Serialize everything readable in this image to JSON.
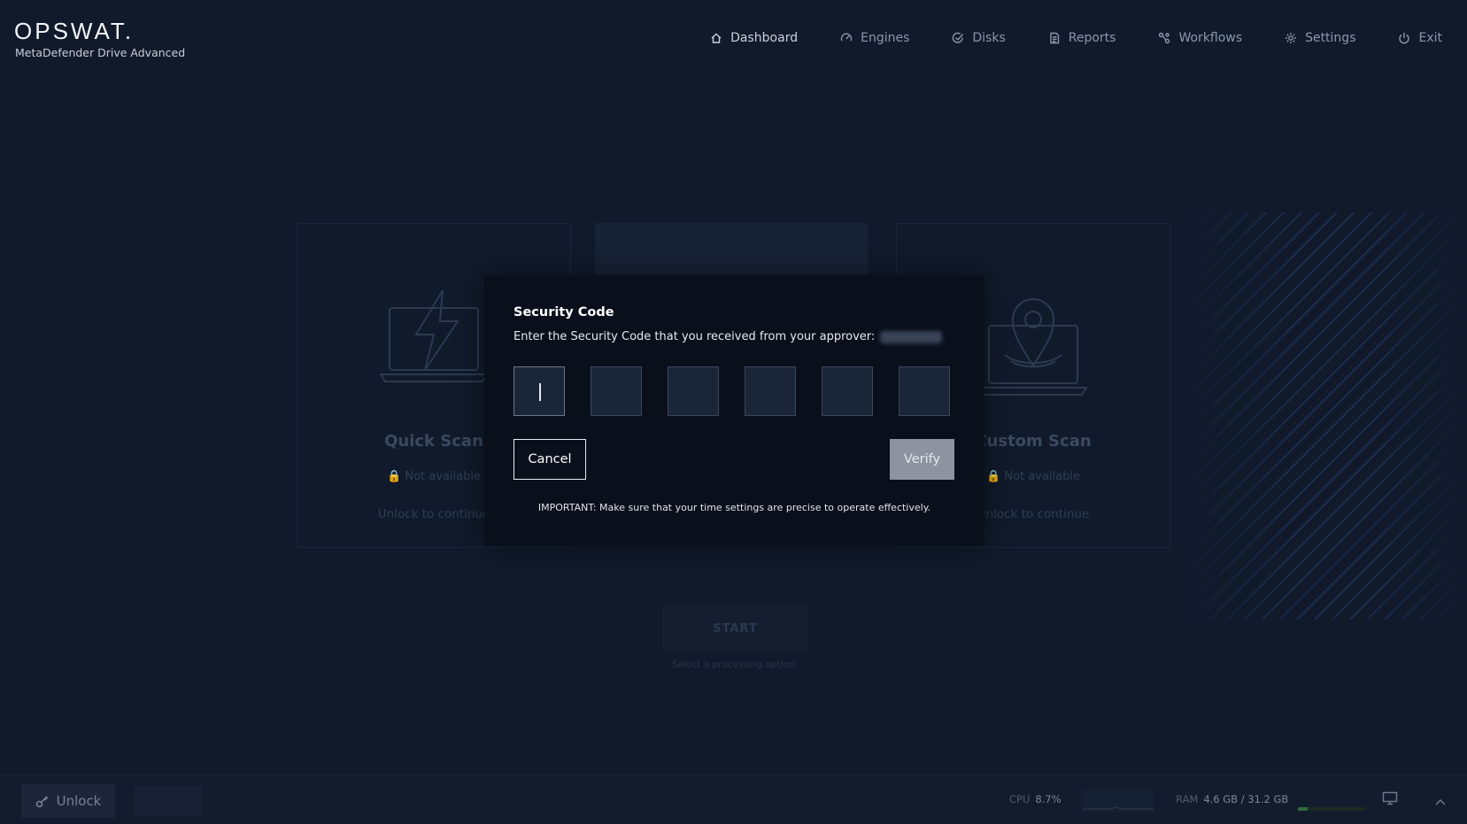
{
  "app": {
    "logo": "OPSWAT.",
    "subtitle": "MetaDefender Drive Advanced"
  },
  "nav": {
    "items": [
      {
        "label": "Dashboard",
        "icon": "home-icon"
      },
      {
        "label": "Engines",
        "icon": "gauge-icon"
      },
      {
        "label": "Disks",
        "icon": "check-shield-icon"
      },
      {
        "label": "Reports",
        "icon": "document-icon"
      },
      {
        "label": "Workflows",
        "icon": "workflow-icon"
      },
      {
        "label": "Settings",
        "icon": "gear-icon"
      },
      {
        "label": "Exit",
        "icon": "power-icon"
      }
    ]
  },
  "cards": {
    "quick": {
      "title": "Quick Scan",
      "status": "Not available",
      "hint": "Unlock to continue"
    },
    "custom": {
      "title": "Custom Scan",
      "status": "Not available",
      "hint": "Unlock to continue"
    }
  },
  "start": {
    "label": "START",
    "hint": "Select a processing option."
  },
  "modal": {
    "title": "Security Code",
    "description": "Enter the Security Code that you received from your approver:",
    "code_boxes": [
      "",
      "",
      "",
      "",
      "",
      ""
    ],
    "cancel_label": "Cancel",
    "verify_label": "Verify",
    "note": "IMPORTANT: Make sure that your time settings are precise to operate effectively."
  },
  "footer": {
    "unlock_label": "Unlock",
    "cpu_label": "CPU",
    "cpu_value": "8.7%",
    "ram_label": "RAM",
    "ram_value": "4.6 GB / 31.2 GB",
    "ram_usage_fraction": 0.15
  },
  "colors": {
    "background": "#111a2b",
    "modal": "#0a0f1c",
    "verify_disabled": "#8d94a0",
    "stripe_accent": "#284882"
  }
}
